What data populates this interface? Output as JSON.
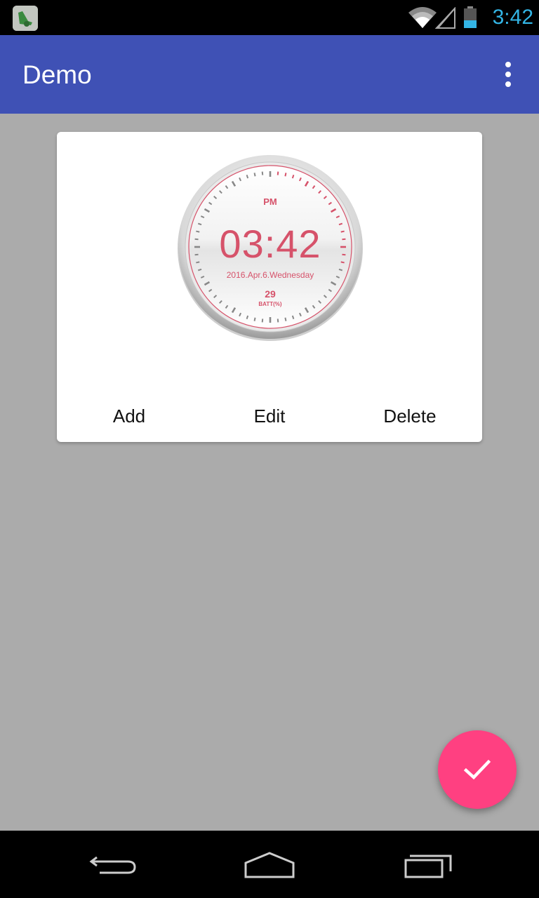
{
  "status_bar": {
    "time": "3:42",
    "time_color": "#33b5e5",
    "icons": [
      "app-notification-icon",
      "wifi-icon",
      "signal-icon",
      "battery-icon"
    ]
  },
  "app_bar": {
    "title": "Demo",
    "background": "#3f51b5",
    "menu_icon": "overflow-menu-icon"
  },
  "card": {
    "clock": {
      "ampm": "PM",
      "time": "03:42",
      "date": "2016.Apr.6.Wednesday",
      "battery_value": "29",
      "battery_label": "BATT(%)",
      "accent": "#d6526a"
    },
    "actions": {
      "add": "Add",
      "edit": "Edit",
      "delete": "Delete"
    }
  },
  "fab": {
    "icon": "check-icon",
    "color": "#ff4081"
  },
  "nav_bar": {
    "icons": [
      "back-icon",
      "home-icon",
      "recents-icon"
    ]
  }
}
